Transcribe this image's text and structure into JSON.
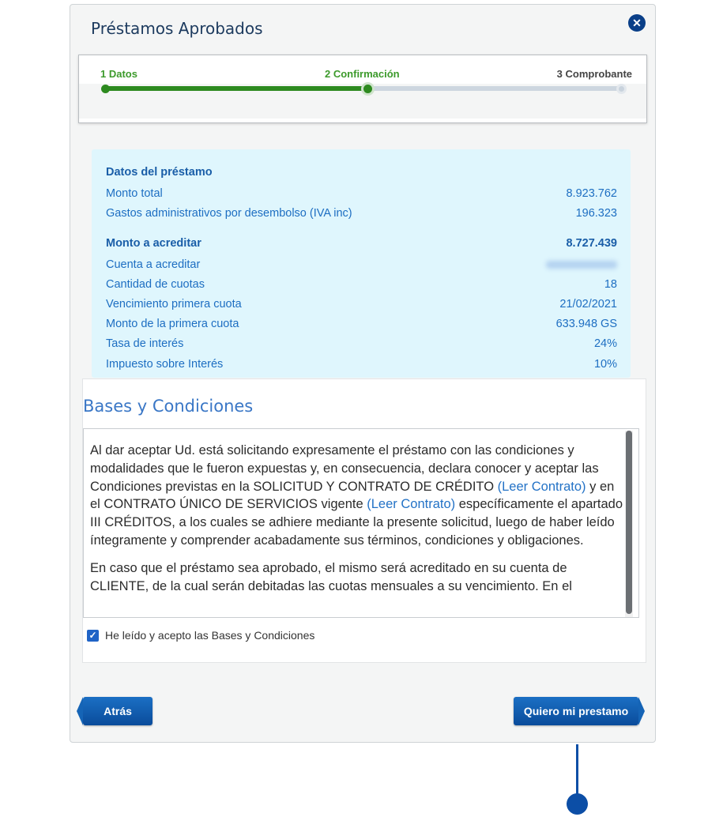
{
  "modal": {
    "title": "Préstamos Aprobados",
    "close_icon": "close-icon"
  },
  "stepper": {
    "steps": [
      {
        "label": "1 Datos",
        "state": "done"
      },
      {
        "label": "2 Confirmación",
        "state": "current"
      },
      {
        "label": "3 Comprobante",
        "state": "pending"
      }
    ],
    "colors": {
      "active": "#2d8a1f",
      "pending": "#cdd6df"
    }
  },
  "loan": {
    "heading": "Datos del préstamo",
    "rows": [
      {
        "label": "Monto total",
        "value": "8.923.762"
      },
      {
        "label": "Gastos administrativos por desembolso (IVA inc)",
        "value": "196.323"
      },
      {
        "label": "Monto a acreditar",
        "value": "8.727.439"
      },
      {
        "label": "Cuenta a acreditar",
        "value": ""
      },
      {
        "label": "Cantidad de cuotas",
        "value": "18"
      },
      {
        "label": "Vencimiento primera cuota",
        "value": "21/02/2021"
      },
      {
        "label": "Monto de la primera cuota",
        "value": "633.948 GS"
      },
      {
        "label": "Tasa de interés",
        "value": "24%"
      },
      {
        "label": "Impuesto sobre Interés",
        "value": "10%"
      }
    ]
  },
  "terms": {
    "title": "Bases y Condiciones",
    "p1_a": "Al dar aceptar Ud. está solicitando expresamente el préstamo con las condiciones y modalidades que le fueron expuestas y, en consecuencia, declara conocer y aceptar las Condiciones previstas en la SOLICITUD Y CONTRATO DE CRÉDITO ",
    "link1": "(Leer Contrato)",
    "p1_b": " y en el CONTRATO ÚNICO DE SERVICIOS vigente ",
    "link2": "(Leer Contrato)",
    "p1_c": " específicamente el apartado III CRÉDITOS, a los cuales se adhiere mediante la presente solicitud, luego de haber leído íntegramente y comprender acabadamente sus términos, condiciones y obligaciones.",
    "p2": "En caso que el préstamo sea aprobado, el mismo será acreditado en su cuenta de CLIENTE, de la cual serán debitadas las cuotas mensuales a su vencimiento. En el",
    "checkbox_label": "He leído y acepto las Bases y Condiciones",
    "checked": true
  },
  "buttons": {
    "back": "Atrás",
    "next": "Quiero mi prestamo"
  },
  "colors": {
    "primary": "#0a4c9b",
    "panel_bg": "#dff6fd",
    "panel_text": "#1d6ec2"
  }
}
